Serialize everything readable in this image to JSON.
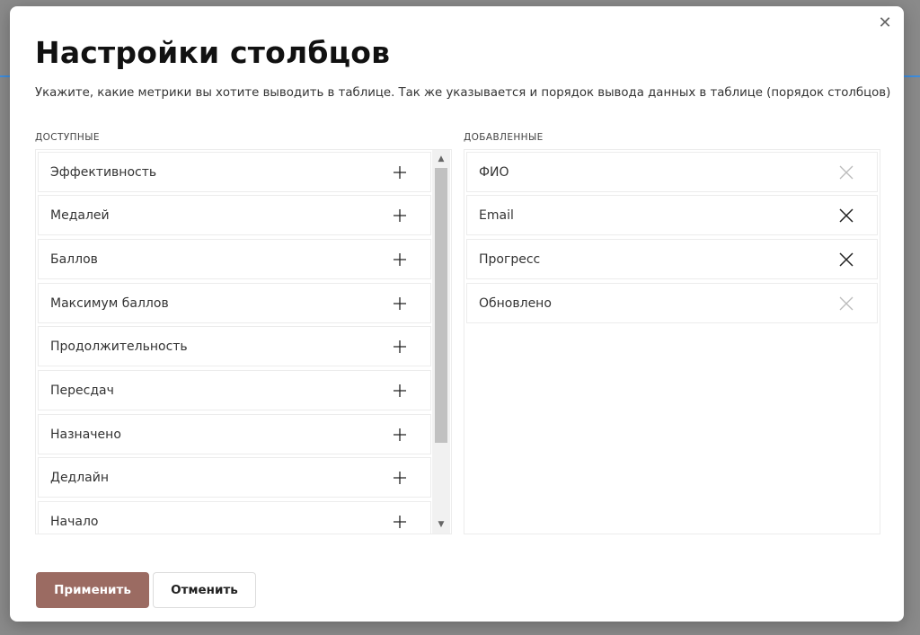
{
  "modal": {
    "title": "Настройки столбцов",
    "description": "Укажите, какие метрики вы хотите выводить в таблице. Так же указывается и порядок вывода данных в таблице (порядок столбцов)",
    "close_icon": "close-icon"
  },
  "available": {
    "heading": "ДОСТУПНЫЕ",
    "items": [
      {
        "label": "Эффективность"
      },
      {
        "label": "Медалей"
      },
      {
        "label": "Баллов"
      },
      {
        "label": "Максимум баллов"
      },
      {
        "label": "Продолжительность"
      },
      {
        "label": "Пересдач"
      },
      {
        "label": "Назначено"
      },
      {
        "label": "Дедлайн"
      },
      {
        "label": "Начало"
      }
    ],
    "add_icon": "plus-icon"
  },
  "added": {
    "heading": "ДОБАВЛЕННЫЕ",
    "items": [
      {
        "label": "ФИО",
        "removable": false
      },
      {
        "label": "Email",
        "removable": true
      },
      {
        "label": "Прогресс",
        "removable": true
      },
      {
        "label": "Обновлено",
        "removable": false
      }
    ],
    "remove_icon": "x-icon"
  },
  "buttons": {
    "apply": "Применить",
    "cancel": "Отменить"
  },
  "colors": {
    "apply_button": "#9b6b62",
    "overlay": "#8a8a8a",
    "icon_active": "#222222",
    "icon_disabled": "#bbbbbb"
  }
}
